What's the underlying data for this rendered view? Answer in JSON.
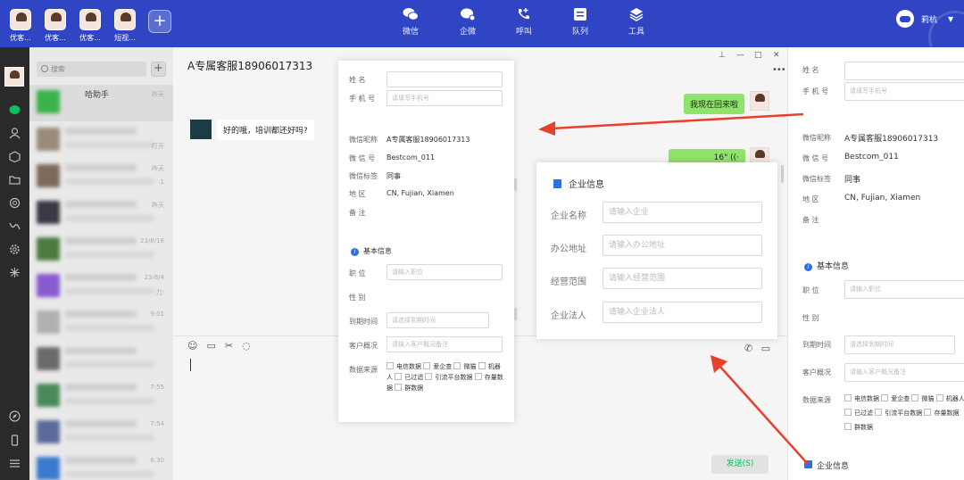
{
  "accounts": [
    {
      "label": "优客..."
    },
    {
      "label": "优客..."
    },
    {
      "label": "优客..."
    },
    {
      "label": "短视..."
    }
  ],
  "nav": [
    {
      "label": "微信"
    },
    {
      "label": "企微"
    },
    {
      "label": "呼叫"
    },
    {
      "label": "队列"
    },
    {
      "label": "工具"
    }
  ],
  "user": {
    "name": "莉杭"
  },
  "convlist": {
    "search_placeholder": "搜索",
    "items": [
      {
        "name": "哈助手",
        "time": "昨天",
        "extra": ""
      },
      {
        "name": "",
        "time": "",
        "extra": "叮开"
      },
      {
        "name": "",
        "time": "昨天",
        "extra": ":1"
      },
      {
        "name": "",
        "time": "昨天",
        "extra": ""
      },
      {
        "name": "",
        "time": "23/8/18",
        "extra": ""
      },
      {
        "name": "",
        "time": "23/8/4",
        "extra": "力:"
      },
      {
        "name": "",
        "time": "9:01",
        "extra": ""
      },
      {
        "name": "",
        "time": "",
        "extra": ""
      },
      {
        "name": "",
        "time": "7:55",
        "extra": ""
      },
      {
        "name": "",
        "time": "7:54",
        "extra": ""
      },
      {
        "name": "",
        "time": "6:30",
        "extra": ""
      }
    ]
  },
  "chat": {
    "title": "A专属客服18906017313",
    "incoming": "好的哦，培训都还好吗?",
    "outgoing1": "我现在回来啦",
    "outgoing2": "16\" ((·",
    "send_label": "发送(S)"
  },
  "form": {
    "name_label": "姓  名",
    "phone_label": "手 机 号",
    "phone_placeholder": "请填写手机号",
    "nick_label": "微信昵称",
    "nick_value": "A专属客服18906017313",
    "wxid_label": "微 信 号",
    "wxid_value": "Bestcom_011",
    "tag_label": "微信标签",
    "tag_value": "同事",
    "region_label": "地  区",
    "region_value": "CN, Fujian, Xiamen",
    "remark_label": "备  注",
    "basic_title": "基本信息",
    "job_label": "职  位",
    "job_placeholder": "请输入职位",
    "gender_label": "性  别",
    "expire_label": "到期时间",
    "expire_placeholder": "请选择到期时间",
    "cust_label": "客户概况",
    "cust_placeholder": "请输入客户概况备注",
    "source_label": "数据来源",
    "sources": [
      "电信数据",
      "爱企查",
      "微猫",
      "机器人",
      "已过滤",
      "引流平台数据",
      "存量数据",
      "群数据"
    ],
    "ent_title": "企业信息"
  },
  "enterprise": {
    "title": "企业信息",
    "fields": [
      {
        "label": "企业名称",
        "placeholder": "请输入企业"
      },
      {
        "label": "办公地址",
        "placeholder": "请输入办公地址"
      },
      {
        "label": "经营范围",
        "placeholder": "请输入经营范围"
      },
      {
        "label": "企业法人",
        "placeholder": "请输入企业法人"
      }
    ]
  },
  "colors": {
    "topbar": "#2f45c4",
    "accent_green": "#8fe36a",
    "arrow_red": "#e8402c"
  }
}
